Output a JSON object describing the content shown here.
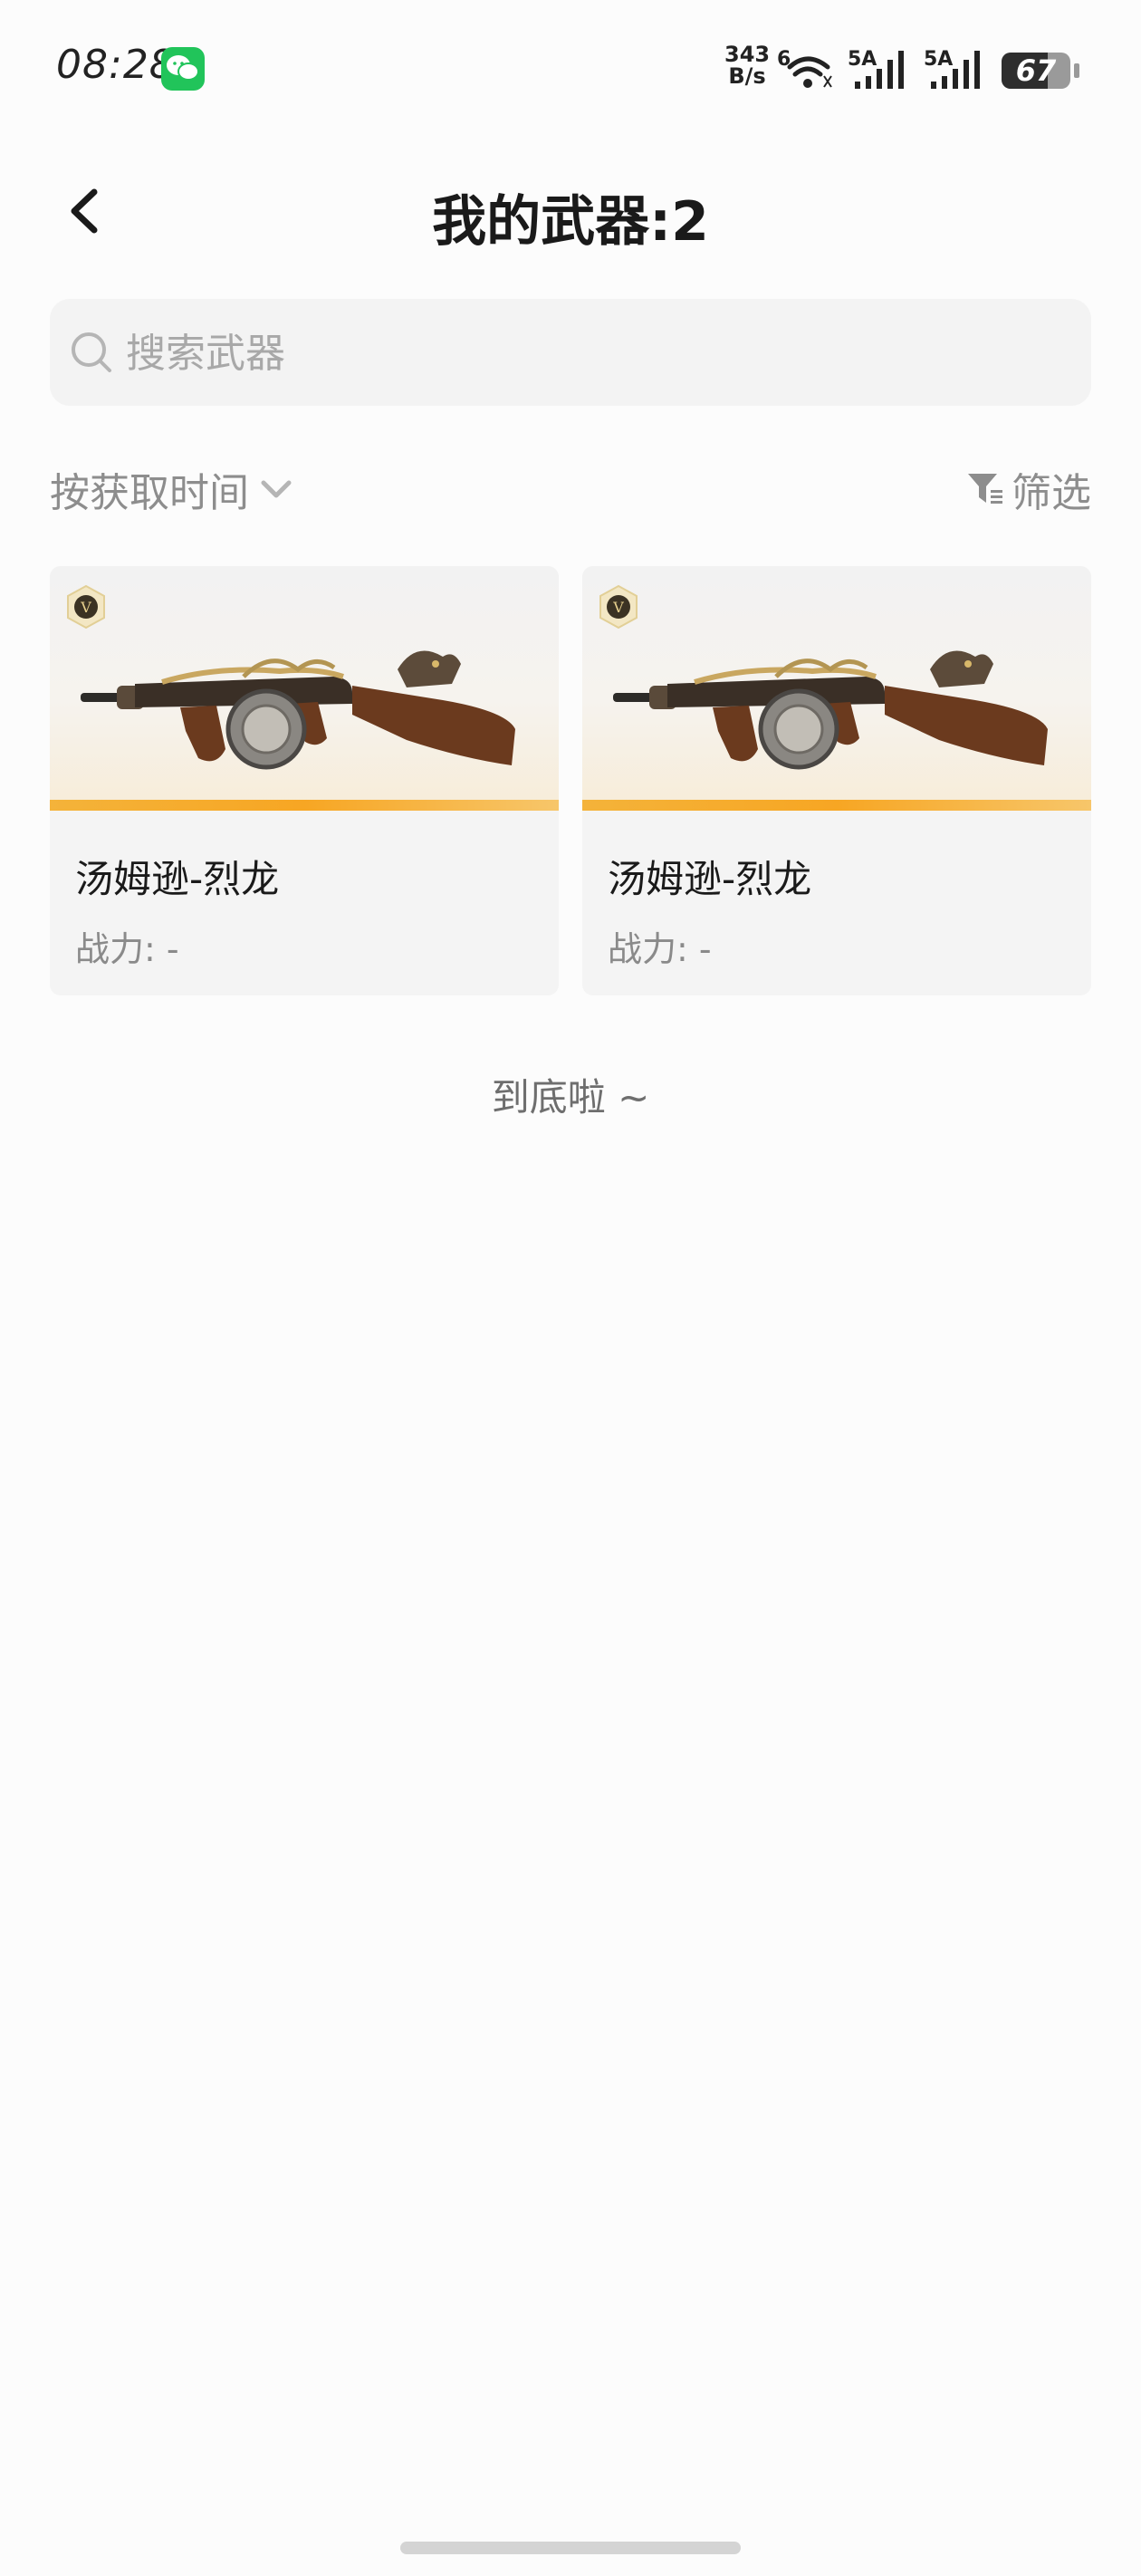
{
  "status_bar": {
    "time": "08:28",
    "net_speed_value": "343",
    "net_speed_unit": "B/s",
    "wifi_label": "6",
    "signal1_label": "5A",
    "signal2_label": "5A",
    "battery_level": "67",
    "app_icon": "wechat-icon"
  },
  "header": {
    "title": "我的武器:2",
    "back_icon": "chevron-left-icon"
  },
  "search": {
    "placeholder": "搜索武器",
    "value": ""
  },
  "sort": {
    "label": "按获取时间",
    "icon": "chevron-down-icon"
  },
  "filter": {
    "label": "筛选",
    "icon": "filter-icon"
  },
  "weapons": [
    {
      "name": "汤姆逊-烈龙",
      "power": "战力: -",
      "rarity_badge": "V"
    },
    {
      "name": "汤姆逊-烈龙",
      "power": "战力: -",
      "rarity_badge": "V"
    }
  ],
  "list_end_text": "到底啦 ~",
  "colors": {
    "accent_orange": "#f7a623",
    "text_secondary": "#8d8d8d",
    "card_bg": "#f4f4f4"
  }
}
